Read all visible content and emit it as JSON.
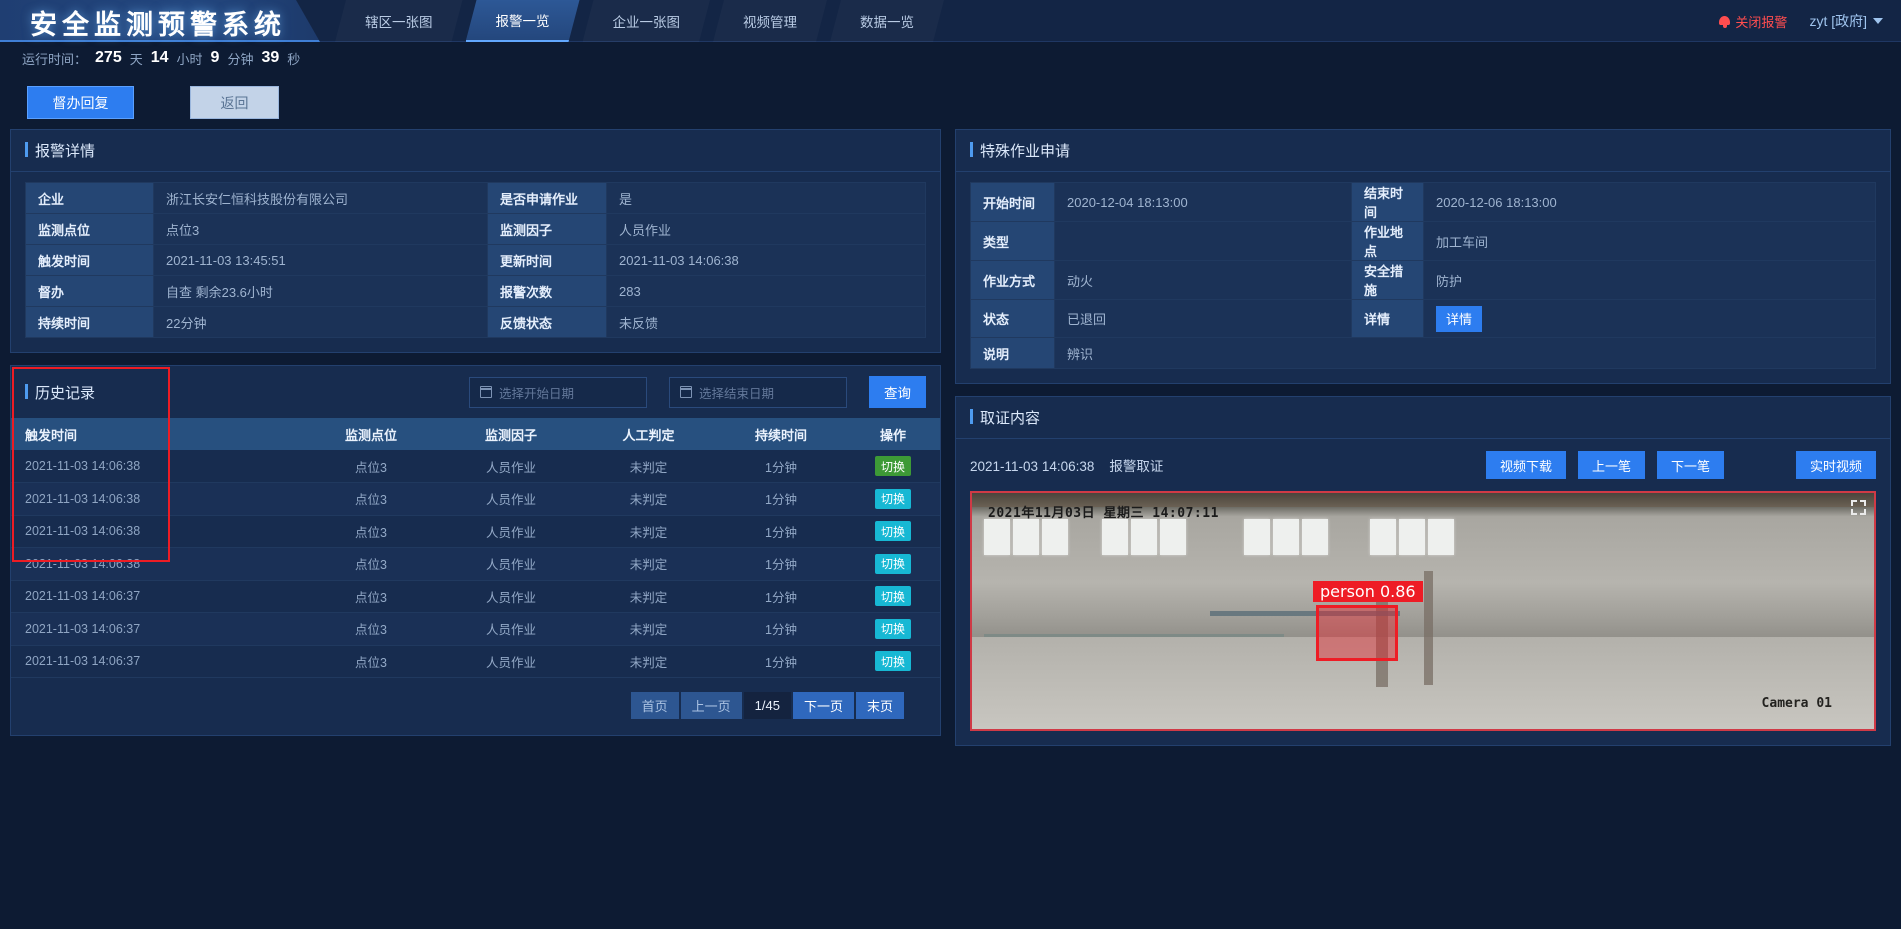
{
  "header": {
    "logo": "安全监测预警系统",
    "nav": [
      {
        "label": "辖区一张图",
        "active": false
      },
      {
        "label": "报警一览",
        "active": true
      },
      {
        "label": "企业一张图",
        "active": false
      },
      {
        "label": "视频管理",
        "active": false
      },
      {
        "label": "数据一览",
        "active": false
      }
    ],
    "alarm_close": "关闭报警",
    "user": "zyt [政府]",
    "accent": "#2d7df0",
    "danger": "#f5222d"
  },
  "runtime": {
    "prefix": "运行时间：",
    "days": "275",
    "days_unit": "天",
    "hours": "14",
    "hours_unit": "小时",
    "minutes": "9",
    "minutes_unit": "分钟",
    "seconds": "39",
    "seconds_unit": "秒"
  },
  "actions": {
    "supervise_reply": "督办回复",
    "back": "返回"
  },
  "alarm_detail": {
    "title": "报警详情",
    "rows": [
      {
        "k1": "企业",
        "v1": "浙江长安仁恒科技股份有限公司",
        "v1style": "link",
        "k2": "是否申请作业",
        "v2": "是",
        "v2style": ""
      },
      {
        "k1": "监测点位",
        "v1": "点位3",
        "v1style": "",
        "k2": "监测因子",
        "v2": "人员作业",
        "v2style": ""
      },
      {
        "k1": "触发时间",
        "v1": "2021-11-03 13:45:51",
        "v1style": "",
        "k2": "更新时间",
        "v2": "2021-11-03 14:06:38",
        "v2style": ""
      },
      {
        "k1": "督办",
        "v1": "自查 剩余23.6小时",
        "v1style": "danger",
        "k2": "报警次数",
        "v2": "283",
        "v2style": ""
      },
      {
        "k1": "持续时间",
        "v1": "22分钟",
        "v1style": "",
        "k2": "反馈状态",
        "v2": "未反馈",
        "v2style": "danger"
      }
    ]
  },
  "special_work": {
    "title": "特殊作业申请",
    "rows": [
      {
        "k1": "开始时间",
        "v1": "2020-12-04 18:13:00",
        "k2": "结束时间",
        "v2": "2020-12-06 18:13:00"
      },
      {
        "k1": "类型",
        "v1": "",
        "k2": "作业地点",
        "v2": "加工车间"
      },
      {
        "k1": "作业方式",
        "v1": "动火",
        "k2": "安全措施",
        "v2": "防护"
      },
      {
        "k1": "状态",
        "v1": "已退回",
        "k2": "详情",
        "v2": "",
        "v2button": "详情"
      },
      {
        "k1": "说明",
        "v1": "辨识",
        "k2": "",
        "v2": ""
      }
    ]
  },
  "history": {
    "title": "历史记录",
    "start_date_placeholder": "选择开始日期",
    "end_date_placeholder": "选择结束日期",
    "query_label": "查询",
    "columns": [
      "触发时间",
      "监测点位",
      "监测因子",
      "人工判定",
      "持续时间",
      "操作"
    ],
    "rows": [
      {
        "time": "2021-11-03 14:06:38",
        "point": "点位3",
        "factor": "人员作业",
        "judge": "未判定",
        "duration": "1分钟",
        "action": "切换",
        "action_color": "green"
      },
      {
        "time": "2021-11-03 14:06:38",
        "point": "点位3",
        "factor": "人员作业",
        "judge": "未判定",
        "duration": "1分钟",
        "action": "切换",
        "action_color": "cyan"
      },
      {
        "time": "2021-11-03 14:06:38",
        "point": "点位3",
        "factor": "人员作业",
        "judge": "未判定",
        "duration": "1分钟",
        "action": "切换",
        "action_color": "cyan"
      },
      {
        "time": "2021-11-03 14:06:38",
        "point": "点位3",
        "factor": "人员作业",
        "judge": "未判定",
        "duration": "1分钟",
        "action": "切换",
        "action_color": "cyan"
      },
      {
        "time": "2021-11-03 14:06:37",
        "point": "点位3",
        "factor": "人员作业",
        "judge": "未判定",
        "duration": "1分钟",
        "action": "切换",
        "action_color": "cyan"
      },
      {
        "time": "2021-11-03 14:06:37",
        "point": "点位3",
        "factor": "人员作业",
        "judge": "未判定",
        "duration": "1分钟",
        "action": "切换",
        "action_color": "cyan"
      },
      {
        "time": "2021-11-03 14:06:37",
        "point": "点位3",
        "factor": "人员作业",
        "judge": "未判定",
        "duration": "1分钟",
        "action": "切换",
        "action_color": "cyan"
      }
    ],
    "pager": {
      "first": "首页",
      "prev": "上一页",
      "current": "1/45",
      "next": "下一页",
      "last": "末页"
    }
  },
  "evidence": {
    "title": "取证内容",
    "record_time": "2021-11-03 14:06:38",
    "record_label": "报警取证",
    "buttons": {
      "download": "视频下载",
      "prev": "上一笔",
      "next": "下一笔",
      "live": "实时视频"
    },
    "video": {
      "timestamp": "2021年11月03日  星期三  14:07:11",
      "camera": "Camera 01",
      "detection_label": "person 0.86",
      "detection_color": "#ee1c25"
    }
  }
}
